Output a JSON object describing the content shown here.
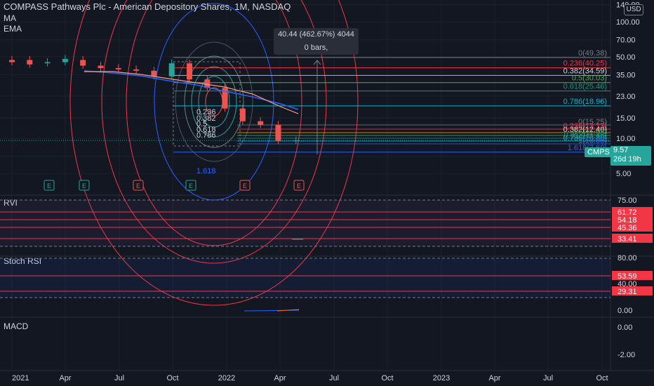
{
  "header": {
    "title": "COMPASS Pathways Plc - American Depository Shares, 1M, NASDAQ",
    "indicators": [
      "MA",
      "EMA"
    ],
    "currency": "USD"
  },
  "tooltip": {
    "line1": "40.44 (462.67%) 4044",
    "line2": "0 bars,"
  },
  "ticker": {
    "symbol": "CMPS",
    "price": "9.57",
    "countdown": "26d 19h",
    "color": "#26a69a"
  },
  "colors": {
    "background": "#131722",
    "up": "#26a69a",
    "down": "#ef5350",
    "grid": "#1e222d",
    "fib_blue": "#2962ff",
    "fib_red": "#f23645"
  },
  "chart_data": [
    {
      "type": "line",
      "title": "COMPASS Pathways Plc - American Depository Shares, 1M, NASDAQ",
      "y_scale": "log",
      "y_ticks": [
        "140.00",
        "100.00",
        "70.00",
        "50.00",
        "35.00",
        "23.00",
        "15.00",
        "10.00",
        "7.00",
        "5.00"
      ],
      "x_ticks": [
        "2021",
        "Apr",
        "Jul",
        "Oct",
        "2022",
        "Apr",
        "Jul",
        "Oct",
        "2023",
        "Apr",
        "Jul",
        "Oct"
      ],
      "series": [
        {
          "name": "CMPS",
          "x": [
            "2021-01",
            "2021-02",
            "2021-03",
            "2021-04",
            "2021-05",
            "2021-06",
            "2021-07",
            "2021-08",
            "2021-09",
            "2021-10",
            "2021-11",
            "2021-12",
            "2022-01",
            "2022-02",
            "2022-03",
            "2022-04",
            "2022-05"
          ],
          "open": [
            47,
            47,
            44,
            45,
            47,
            42,
            40,
            39,
            38,
            34,
            44,
            32,
            27,
            18,
            14,
            13,
            9.5
          ],
          "close": [
            45,
            43,
            45,
            48,
            42,
            40,
            39,
            38,
            34,
            44,
            32,
            27,
            18,
            14,
            13,
            9.5,
            9.57
          ]
        }
      ],
      "fib_retracement_1": [
        {
          "level": "0",
          "value": "49.38"
        },
        {
          "level": "0.236",
          "value": "40.25"
        },
        {
          "level": "0.382",
          "value": "34.59"
        },
        {
          "level": "0.5",
          "value": "30.03"
        },
        {
          "level": "0.618",
          "value": "25.46"
        },
        {
          "level": "0.786",
          "value": "18.96"
        },
        {
          "level": "1.618",
          "value": "7.60"
        }
      ],
      "fib_retracement_2_labels": [
        "0(15.25)",
        "0.236(13.13)",
        "0.382(12.40)",
        "0.5(11.93)",
        "0.618(11.45)",
        "0.786(10.80)",
        "1(10.09)"
      ],
      "fib_circle_labels": [
        "0.236",
        "0.382",
        "0.5",
        "0.618",
        "0.786",
        "1.618"
      ],
      "earnings": [
        "E",
        "E",
        "E",
        "E",
        "E",
        "E"
      ]
    },
    {
      "type": "line",
      "title": "RVI",
      "y_ticks": [
        "75.00"
      ],
      "level_labels": [
        "61.72",
        "54.18",
        "45.36",
        "33.41"
      ]
    },
    {
      "type": "line",
      "title": "Stoch RSI",
      "y_ticks": [
        "80.00",
        "40.00",
        "0.00"
      ],
      "level_labels": [
        "53.59",
        "29.31"
      ]
    },
    {
      "type": "line",
      "title": "MACD",
      "y_ticks": [
        "0.00",
        "-2.00"
      ]
    }
  ]
}
